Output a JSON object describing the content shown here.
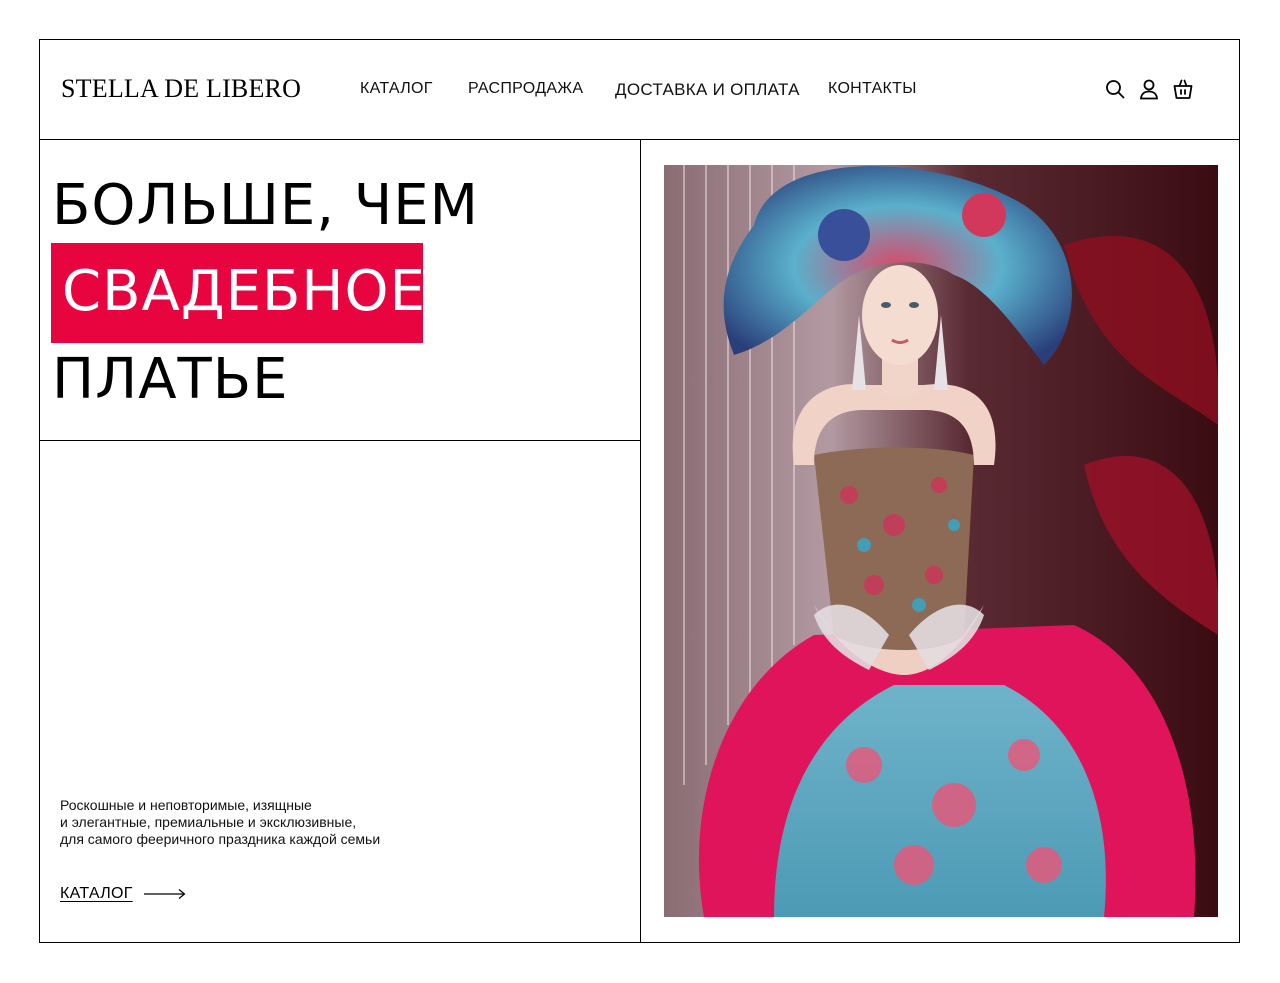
{
  "brand": {
    "name": "STELLA DE LIBERO"
  },
  "nav": {
    "items": [
      {
        "label": "КАТАЛОГ"
      },
      {
        "label": "РАСПРОДАЖА"
      },
      {
        "label": "ДОСТАВКА И ОПЛАТА"
      },
      {
        "label": "КОНТАКТЫ"
      }
    ]
  },
  "header_icons": [
    "search-icon",
    "user-icon",
    "shopping-bag-icon"
  ],
  "hero": {
    "line1": "БОЛЬШЕ, ЧЕМ",
    "line2": "СВАДЕБНОЕ",
    "line3": "ПЛАТЬЕ",
    "description": [
      "Роскошные и неповторимые, изящные",
      "и элегантные, премиальные и эксклюзивные,",
      "для самого фееричного праздника каждой семьи"
    ],
    "cta_label": "КАТАЛОГ"
  },
  "colors": {
    "accent": "#e8053f",
    "text": "#000000",
    "background": "#ffffff"
  }
}
